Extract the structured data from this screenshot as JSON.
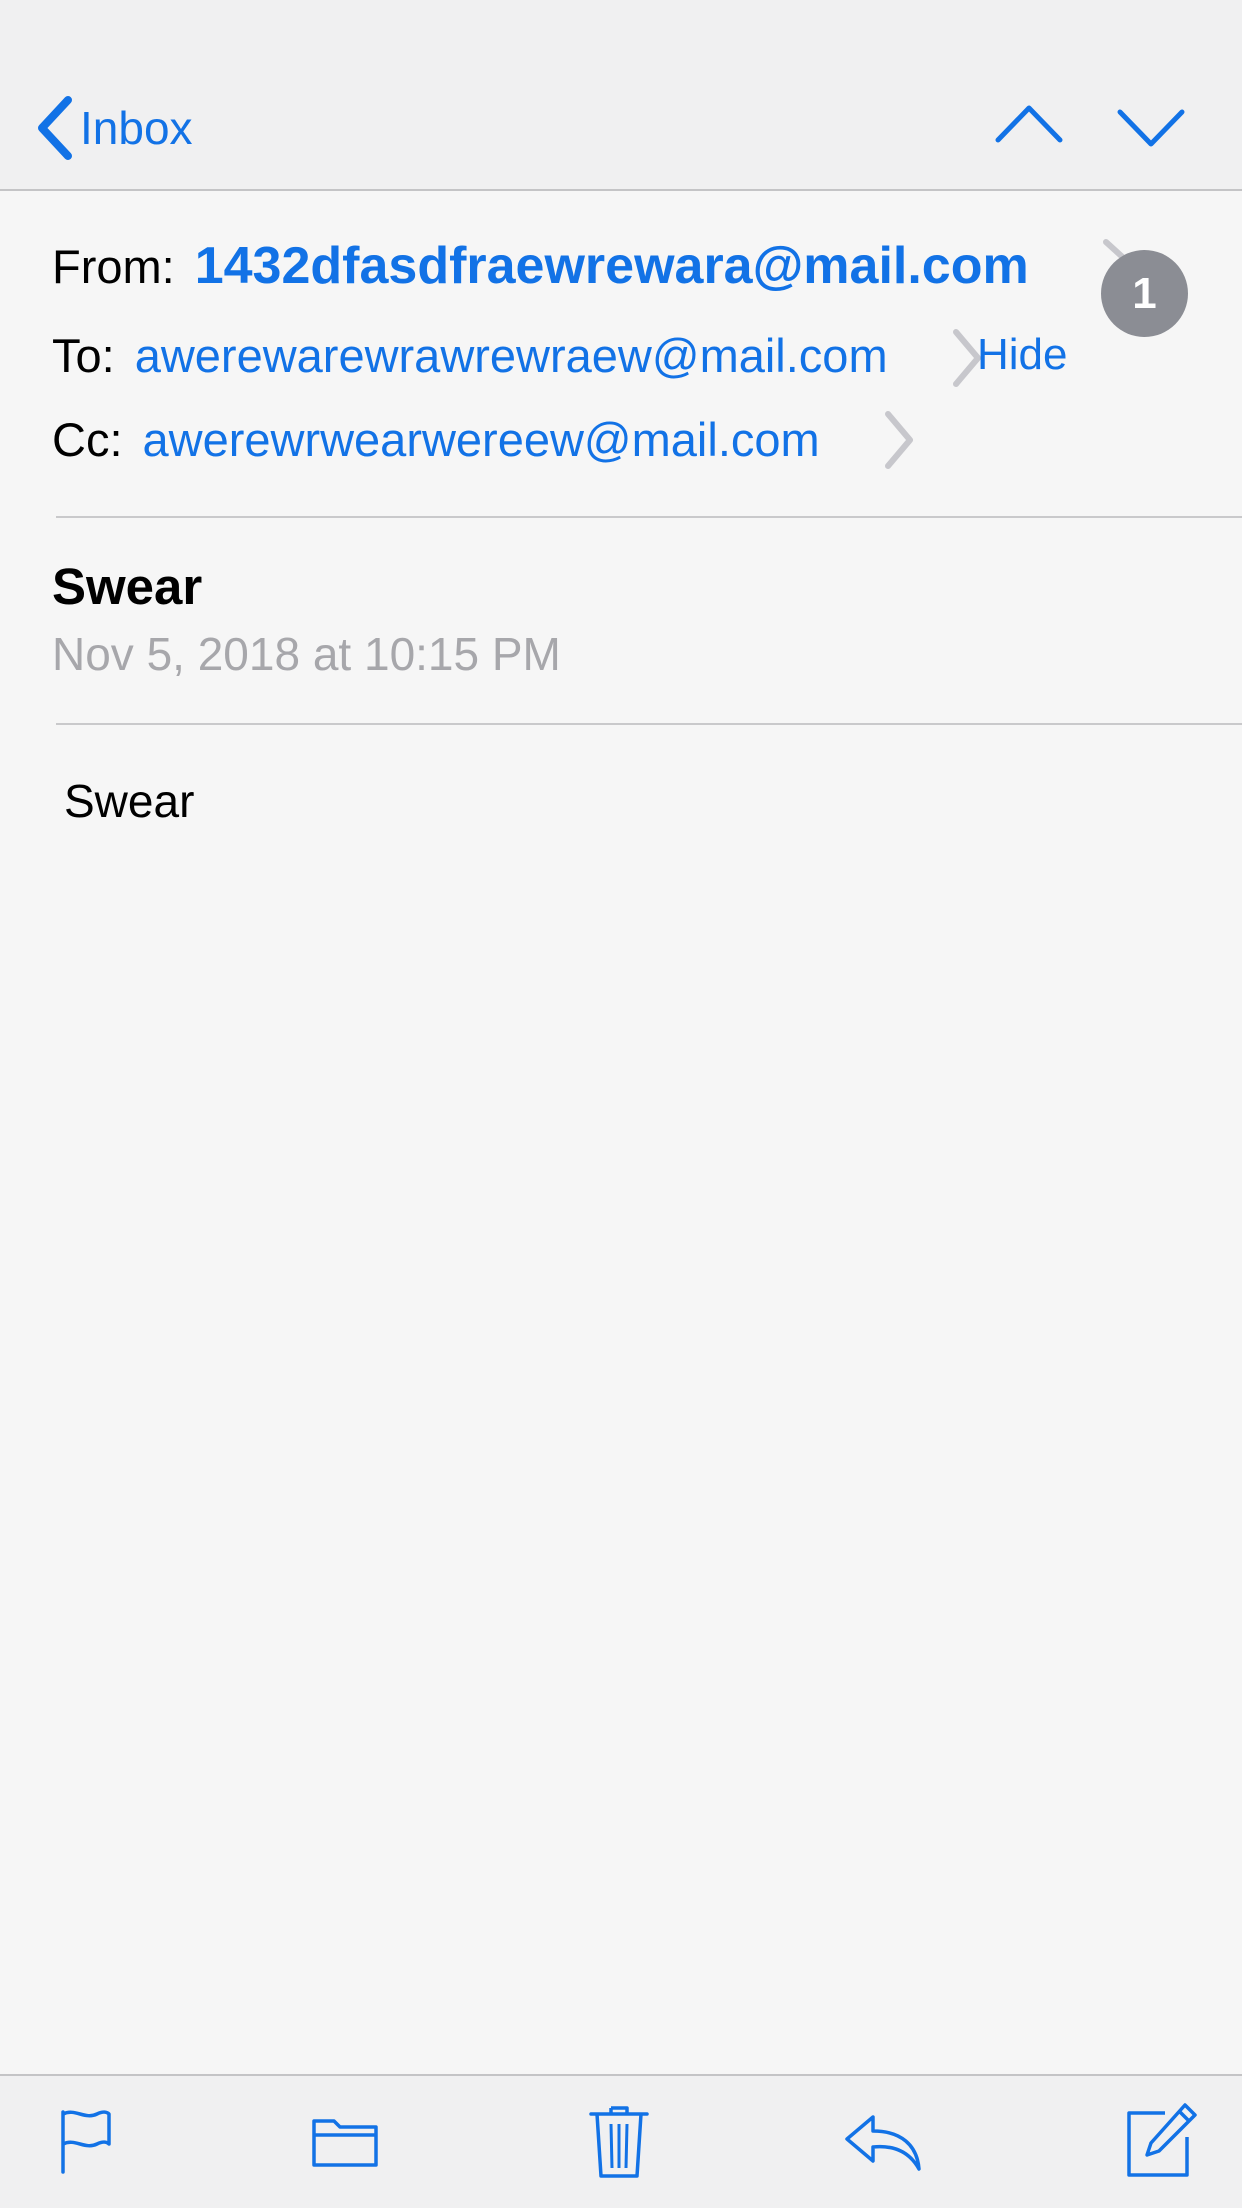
{
  "nav": {
    "back_label": "Inbox",
    "prev_icon": "chevron-up-icon",
    "next_icon": "chevron-down-icon"
  },
  "header": {
    "from_label": "From:",
    "from_value": "1432dfasdfraewrewara@mail.com",
    "to_label": "To:",
    "to_value": "awerewarewrawrewraew@mail.com",
    "cc_label": "Cc:",
    "cc_value": "awerewrwearwereew@mail.com",
    "hide_label": "Hide",
    "badge_count": "1"
  },
  "message": {
    "subject": "Swear",
    "date": "Nov 5, 2018 at 10:15 PM",
    "body": "Swear"
  },
  "toolbar": {
    "icons": [
      "flag-icon",
      "folder-icon",
      "trash-icon",
      "reply-icon",
      "compose-icon"
    ]
  },
  "colors": {
    "accent": "#1272e6",
    "badge": "#8b8d94",
    "secondary_text": "#a7a7ab",
    "bar_background": "#f0f0f1",
    "page_background": "#f6f6f6"
  }
}
